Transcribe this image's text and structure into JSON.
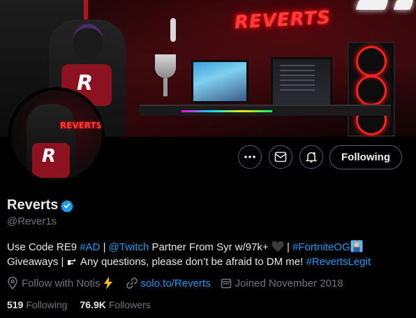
{
  "banner": {
    "neon_sign": "REVERTS"
  },
  "avatar": {
    "sign": "REVERTS"
  },
  "actions": {
    "more_symbol": "•••",
    "follow_label": "Following"
  },
  "profile": {
    "display_name": "Reverts",
    "handle": "@Rever1s",
    "verified": true,
    "accent_color": "#1d9bf0"
  },
  "bio": {
    "p1": "Use Code RE9 ",
    "tag_ad": "#AD",
    "p2": " | ",
    "mention_twitch": "@Twitch",
    "p3": " Partner From Syr w/97k+ ",
    "p4": " | ",
    "tag_fortniteog": "#FortniteOG",
    "p5": "Giveaways | ",
    "p6": " Any questions, please don’t be afraid to DM me! ",
    "tag_revertslegit": "#RevertsLegit"
  },
  "meta": {
    "location": "Follow with Notis",
    "website": "solo.to/Reverts",
    "joined": "Joined November 2018"
  },
  "stats": {
    "following_count": "519",
    "following_label": "Following",
    "followers_count": "76.9K",
    "followers_label": "Followers"
  }
}
